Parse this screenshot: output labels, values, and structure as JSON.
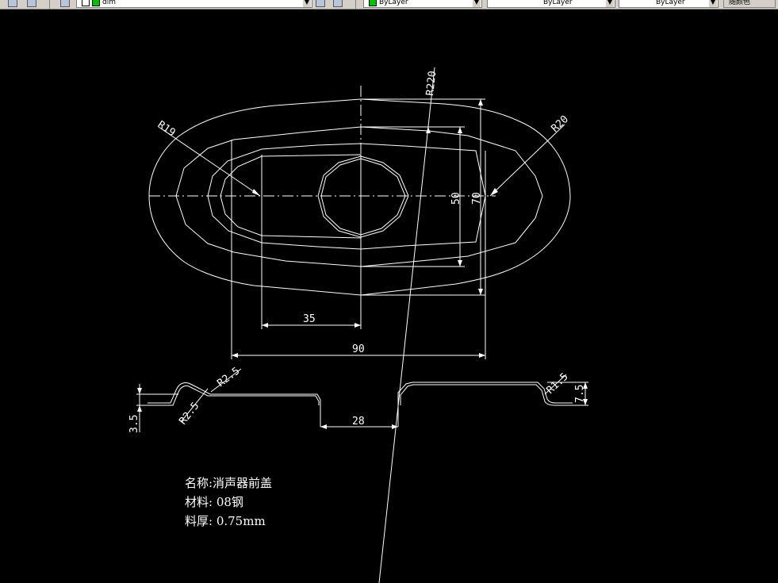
{
  "toolbar": {
    "layer_combo": "dim",
    "color_combo": "ByLayer",
    "linetype_combo": "ByLayer",
    "lineweight_combo": "ByLayer",
    "plotstyle_btn": "随颜色"
  },
  "dimensions": {
    "r220": "R220",
    "r19": "R19",
    "r20": "R20",
    "d50": "50",
    "d70": "70",
    "d35": "35",
    "d90": "90",
    "r2_5_top": "R2.5",
    "r2_5_bottom": "R2.5",
    "r1_5": "R1.5",
    "d7_5": "7.5",
    "d3_5": "3.5",
    "d28": "28"
  },
  "notes": {
    "name": "名称:消声器前盖",
    "material": "材料: 08钢",
    "thickness": "料厚: 0.75mm"
  },
  "colors": {
    "background": "#000000",
    "geometry": "#ffffff",
    "toolbar": "#d4d0c8"
  }
}
